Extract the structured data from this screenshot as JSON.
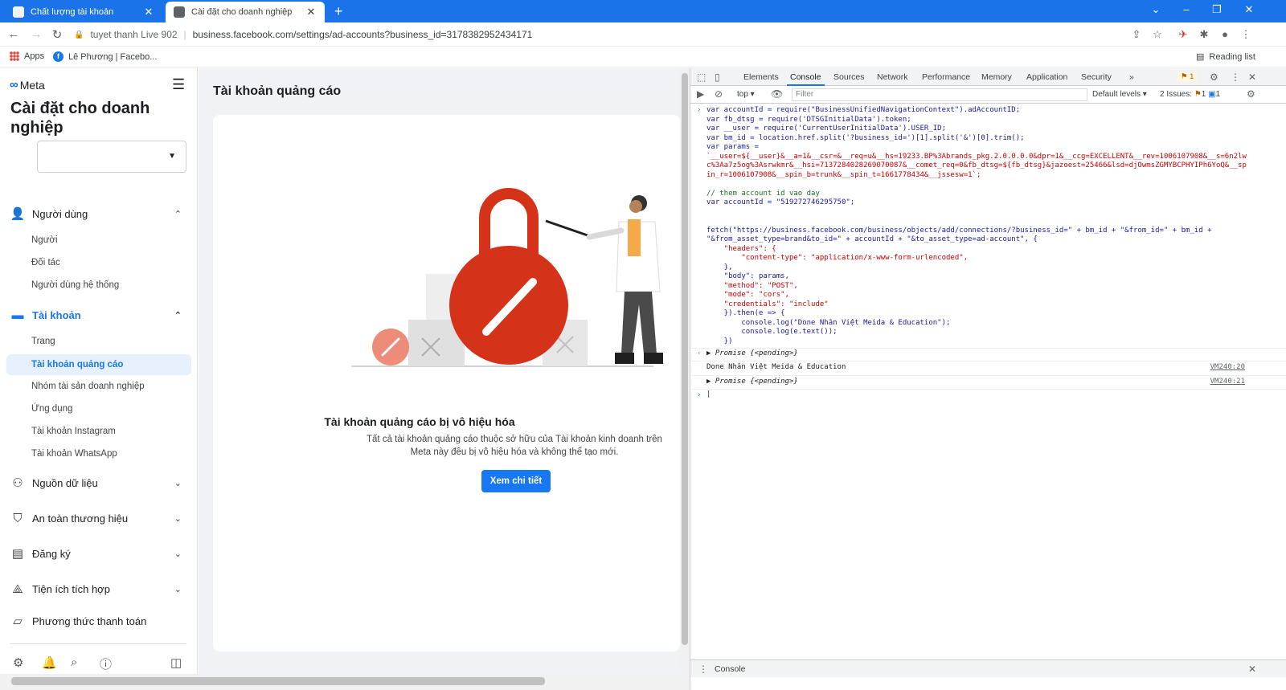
{
  "browser": {
    "tabs": [
      {
        "title": "Chất lượng tài khoản",
        "active": false
      },
      {
        "title": "Cài đặt cho doanh nghiệp",
        "active": true
      }
    ],
    "new_tab": "+",
    "profile": "tuyet thanh Live 902",
    "url": "business.facebook.com/settings/ad-accounts?business_id=3178382952434171",
    "bookmarks": [
      "Apps",
      "Lê Phương | Facebo..."
    ],
    "reading_list": "Reading list"
  },
  "sidebar": {
    "logo": "Meta",
    "title": "Cài đặt cho doanh nghiệp",
    "sections": [
      {
        "label": "Người dùng",
        "icon": "users-icon",
        "expanded": true,
        "items": [
          "Người",
          "Đối tác",
          "Người dùng hệ thống"
        ]
      },
      {
        "label": "Tài khoản",
        "icon": "folder-icon",
        "expanded": true,
        "active": true,
        "items": [
          "Trang",
          "Tài khoản quảng cáo",
          "Nhóm tài sản doanh nghiệp",
          "Ứng dụng",
          "Tài khoản Instagram",
          "Tài khoản WhatsApp"
        ]
      },
      {
        "label": "Nguồn dữ liệu",
        "icon": "data-sources-icon",
        "expanded": false
      },
      {
        "label": "An toàn thương hiệu",
        "icon": "shield-icon",
        "expanded": false
      },
      {
        "label": "Đăng ký",
        "icon": "clipboard-icon",
        "expanded": false
      },
      {
        "label": "Tiện ích tích hợp",
        "icon": "integrations-icon",
        "expanded": false
      },
      {
        "label": "Phương thức thanh toán",
        "icon": "payment-icon",
        "expanded": false
      }
    ],
    "selected_item": "Tài khoản quảng cáo"
  },
  "main": {
    "title": "Tài khoản quảng cáo",
    "empty_title": "Tài khoản quảng cáo bị vô hiệu hóa",
    "empty_desc": "Tất cả tài khoản quảng cáo thuộc sở hữu của Tài khoản kinh doanh trên Meta này đều bị vô hiệu hóa và không thể tạo mới.",
    "cta": "Xem chi tiết"
  },
  "devtools": {
    "tabs": [
      "Elements",
      "Console",
      "Sources",
      "Network",
      "Performance",
      "Memory",
      "Application",
      "Security"
    ],
    "active_tab": "Console",
    "more": "»",
    "warn_badge": "1",
    "context": "top",
    "filter_placeholder": "Filter",
    "levels": "Default levels ▾",
    "issues_label": "2 Issues:",
    "issues_warn": "1",
    "issues_info": "1",
    "code": [
      "var accountId = require(\"BusinessUnifiedNavigationContext\").adAccountID;",
      "var fb_dtsg = require('DTSGInitialData').token;",
      "var __user = require('CurrentUserInitialData').USER_ID;",
      "var bm_id = location.href.split('?business_id=')[1].split('&')[0].trim();",
      "var params =",
      "`__user=${__user}&__a=1&__csr=&__req=u&__hs=19233.BP%3Abrands_pkg.2.0.0.0.0&dpr=1&__ccg=EXCELLENT&__rev=1006107908&__s=6n2lw",
      "c%3Aa7z5og%3Asrwkmr&__hsi=7137284028269070087&__comet_req=0&fb_dtsg=${fb_dtsg}&jazoest=25466&lsd=djOwmsZGMYBCPHYIPh6YoQ&__sp",
      "in_r=1006107908&__spin_b=trunk&__spin_t=1661778434&__jssesw=1`;",
      "",
      "// them account id vao day",
      "var accountId = \"519272746295750\";",
      "",
      "",
      "fetch(\"https://business.facebook.com/business/objects/add/connections/?business_id=\" + bm_id + \"&from_id=\" + bm_id +",
      "\"&from_asset_type=brand&to_id=\" + accountId + \"&to_asset_type=ad-account\", {",
      "    \"headers\": {",
      "        \"content-type\": \"application/x-www-form-urlencoded\",",
      "    },",
      "    \"body\": params,",
      "    \"method\": \"POST\",",
      "    \"mode\": \"cors\",",
      "    \"credentials\": \"include\"",
      "    }).then(e => {",
      "        console.log(\"Done Nhân Việt Meida & Education\");",
      "        console.log(e.text());",
      "    })"
    ],
    "out1": "▶ Promise {<pending>}",
    "log": "Done Nhân Việt Meida & Education",
    "log_src": "VM240:20",
    "out2": "▶ Promise {<pending>}",
    "out2_src": "VM240:21",
    "drawer": "Console"
  }
}
